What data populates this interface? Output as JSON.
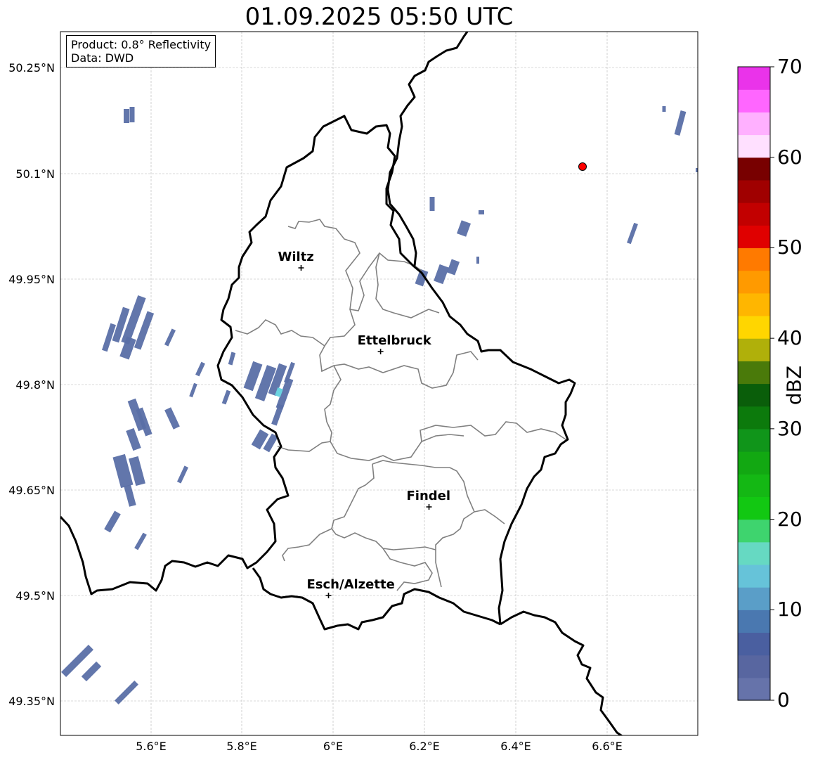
{
  "title": "01.09.2025 05:50 UTC",
  "info": {
    "product": "Product: 0.8° Reflectivity",
    "data": "Data: DWD"
  },
  "axes": {
    "lat_ticks": [
      "50.25°N",
      "50.1°N",
      "49.95°N",
      "49.8°N",
      "49.65°N",
      "49.5°N",
      "49.35°N"
    ],
    "lon_ticks": [
      "5.6°E",
      "5.8°E",
      "6°E",
      "6.2°E",
      "6.4°E",
      "6.6°E"
    ]
  },
  "cities": [
    {
      "name": "Wiltz",
      "lon": 5.93,
      "lat": 49.966
    },
    {
      "name": "Ettelbruck",
      "lon": 6.104,
      "lat": 49.847
    },
    {
      "name": "Findel",
      "lon": 6.21,
      "lat": 49.626
    },
    {
      "name": "Esch/Alzette",
      "lon": 5.99,
      "lat": 49.5
    }
  ],
  "radar_site": {
    "lon": 6.548,
    "lat": 50.11,
    "color": "#ff0000"
  },
  "colorbar": {
    "label": "dBZ",
    "ticks": [
      "70",
      "60",
      "50",
      "40",
      "30",
      "20",
      "10",
      "0"
    ],
    "min": 0,
    "max": 70,
    "step": 2.5,
    "colors": [
      "#6673aa",
      "#5866a0",
      "#4a5fa0",
      "#4a78b0",
      "#5a9ec8",
      "#66c3d9",
      "#66d9c2",
      "#3ed46e",
      "#12c812",
      "#14b814",
      "#12a812",
      "#10951a",
      "#0c7a0c",
      "#0a5e0a",
      "#4a7a0a",
      "#b0b00a",
      "#ffd600",
      "#ffb600",
      "#ff9a00",
      "#ff7a00",
      "#e00000",
      "#c20000",
      "#a00000",
      "#780000",
      "#ffe0ff",
      "#ffb0ff",
      "#ff66ff",
      "#ea33ea"
    ]
  },
  "echo_colors": {
    "main": "#5a6fa6",
    "strong": "#4f5fa0",
    "cyan": "#6ad3e0"
  }
}
